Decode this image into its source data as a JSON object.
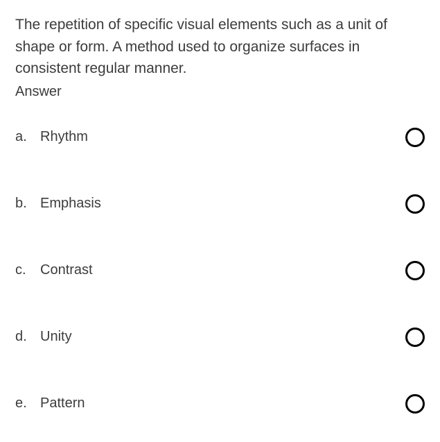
{
  "question": {
    "text": "The repetition of specific visual elements such as a unit of shape or form. A method used to organize surfaces in consistent regular manner.",
    "answer_label": "Answer"
  },
  "options": [
    {
      "letter": "a.",
      "text": "Rhythm"
    },
    {
      "letter": "b.",
      "text": "Emphasis"
    },
    {
      "letter": "c.",
      "text": "Contrast"
    },
    {
      "letter": "d.",
      "text": "Unity"
    },
    {
      "letter": "e.",
      "text": "Pattern"
    }
  ]
}
